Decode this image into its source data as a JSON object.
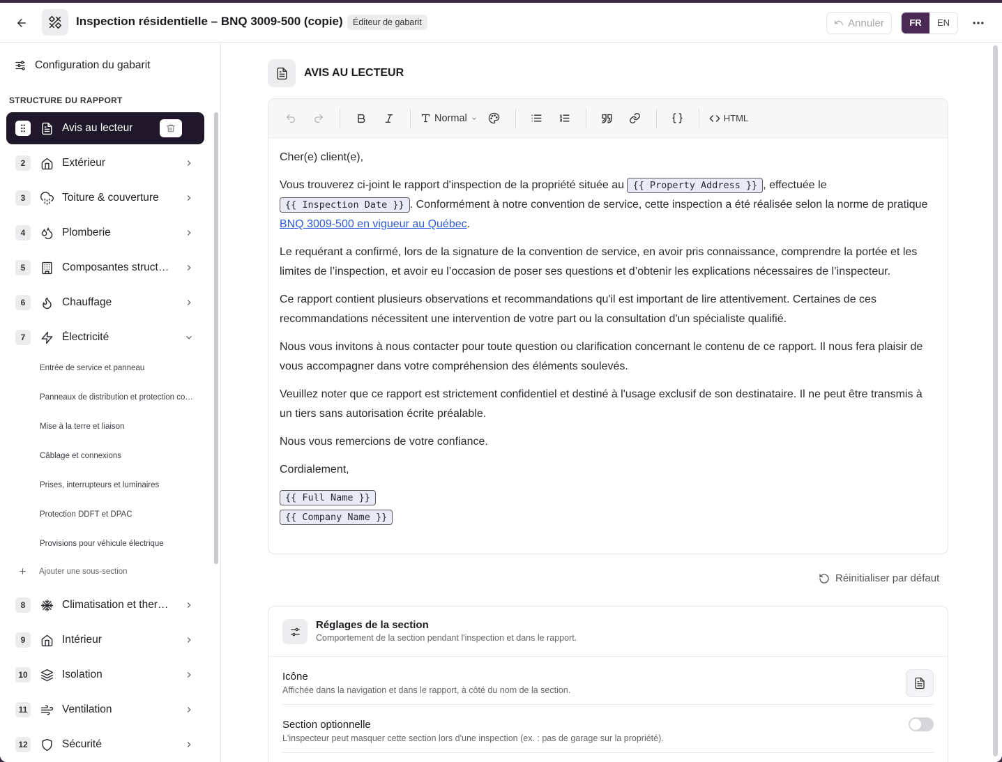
{
  "header": {
    "title": "Inspection résidentielle – BNQ 3009-500 (copie)",
    "badge": "Éditeur de gabarit",
    "undo_label": "Annuler",
    "languages": [
      "FR",
      "EN"
    ],
    "active_language": "FR"
  },
  "sidebar": {
    "config_label": "Configuration du gabarit",
    "structure_label": "STRUCTURE DU RAPPORT",
    "sections": [
      {
        "num": "",
        "label": "Avis au lecteur",
        "icon": "document-icon"
      },
      {
        "num": "2",
        "label": "Extérieur",
        "icon": "home-icon"
      },
      {
        "num": "3",
        "label": "Toiture & couverture",
        "icon": "cloud-rain-icon"
      },
      {
        "num": "4",
        "label": "Plomberie",
        "icon": "droplets-icon"
      },
      {
        "num": "5",
        "label": "Composantes structurales",
        "icon": "building-icon"
      },
      {
        "num": "6",
        "label": "Chauffage",
        "icon": "flame-icon"
      },
      {
        "num": "7",
        "label": "Électricité",
        "icon": "zap-icon"
      },
      {
        "num": "8",
        "label": "Climatisation et thermopompe",
        "icon": "snowflake-icon"
      },
      {
        "num": "9",
        "label": "Intérieur",
        "icon": "home-icon"
      },
      {
        "num": "10",
        "label": "Isolation",
        "icon": "layers-icon"
      },
      {
        "num": "11",
        "label": "Ventilation",
        "icon": "wind-icon"
      },
      {
        "num": "12",
        "label": "Sécurité",
        "icon": "shield-icon"
      }
    ],
    "subsections": [
      "Entrée de service et panneau",
      "Panneaux de distribution et protection contre les surintensités",
      "Mise à la terre et liaison",
      "Câblage et connexions",
      "Prises, interrupteurs et luminaires",
      "Protection DDFT et DPAC",
      "Provisions pour véhicule électrique"
    ],
    "add_subsection_label": "Ajouter une sous-section"
  },
  "main": {
    "section_title": "AVIS AU LECTEUR",
    "toolbar": {
      "block_format": "Normal",
      "html_label": "HTML"
    },
    "content": {
      "greeting": "Cher(e) client(e),",
      "p1_a": "Vous trouverez ci-joint le rapport d'inspection de la propriété située au ",
      "var_property": "{{ Property Address }}",
      "p1_b": ", effectuée le ",
      "var_date": "{{ Inspection Date }}",
      "p1_c": ". Conformément à notre convention de service, cette inspection a été réalisée selon la norme de pratique ",
      "p1_link": "BNQ 3009-500 en vigueur au Québec",
      "p1_d": ".",
      "p2": "Le requérant a confirmé, lors de la signature de la convention de service, en avoir pris connaissance, comprendre la portée et les limites de l’inspection, et avoir eu l’occasion de poser ses questions et d’obtenir les explications nécessaires de l’inspecteur.",
      "p3": "Ce rapport contient plusieurs observations et recommandations qu'il est important de lire attentivement. Certaines de ces recommandations nécessitent une intervention de votre part ou la consultation d'un spécialiste qualifié.",
      "p4": "Nous vous invitons à nous contacter pour toute question ou clarification concernant le contenu de ce rapport. Il nous fera plaisir de vous accompagner dans votre compréhension des éléments soulevés.",
      "p5": "Veuillez noter que ce rapport est strictement confidentiel et destiné à l'usage exclusif de son destinataire. Il ne peut être transmis à un tiers sans autorisation écrite préalable.",
      "p6": "Nous vous remercions de votre confiance.",
      "closing": "Cordialement,",
      "var_name": "{{ Full Name }}",
      "var_company": "{{ Company Name }}"
    },
    "reset_label": "Réinitialiser par défaut",
    "settings": {
      "title": "Réglages de la section",
      "subtitle": "Comportement de la section pendant l'inspection et dans le rapport.",
      "icon_label": "Icône",
      "icon_desc": "Affichée dans la navigation et dans le rapport, à côté du nom de la section.",
      "optional_label": "Section optionnelle",
      "optional_desc": "L'inspecteur peut masquer cette section lors d'une inspection (ex. : pas de garage sur la propriété).",
      "optional_enabled": false
    }
  }
}
